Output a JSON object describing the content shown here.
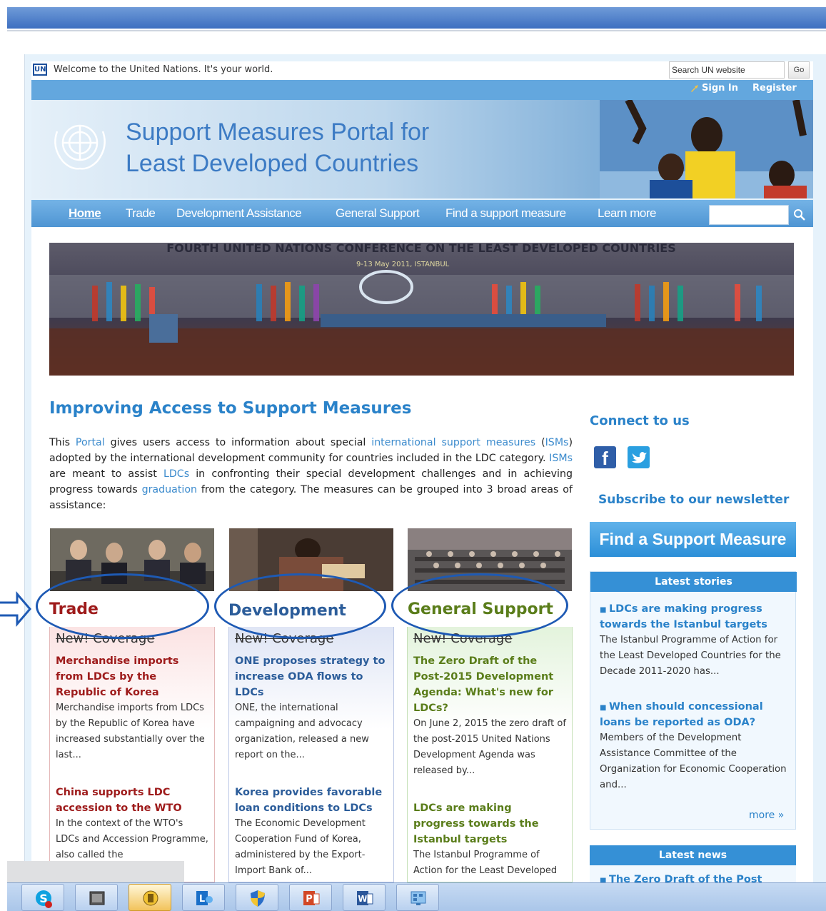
{
  "topbar": {
    "un_logo": "UN",
    "welcome": "Welcome to the United Nations. It's your world.",
    "search_value": "Search UN website",
    "go_label": "Go",
    "sign_in": "Sign In",
    "register": "Register"
  },
  "banner": {
    "title_line1": "Support Measures Portal for",
    "title_line2": "Least Developed Countries"
  },
  "nav": {
    "items": [
      "Home",
      "Trade",
      "Development Assistance",
      "General Support",
      "Find a support measure",
      "Learn more"
    ]
  },
  "hero": {
    "caption": "FOURTH UNITED NATIONS CONFERENCE ON THE LEAST DEVELOPED COUNTRIES",
    "subcaption": "9-13 May 2011, ISTANBUL"
  },
  "main": {
    "heading": "Improving Access to Support Measures",
    "intro": {
      "t1": "This ",
      "l1": "Portal",
      "t2": " gives users access to information about special ",
      "l2": "international support measures",
      "t3": " (",
      "l3": "ISMs",
      "t4": ") adopted by the international development community for countries included in the LDC category. ",
      "l4": "ISMs",
      "t5": " are meant to assist ",
      "l5": "LDCs",
      "t6": " in confronting their special development challenges and in achieving progress towards ",
      "l6": "graduation",
      "t7": " from the category. The measures can be grouped into 3 broad areas of assistance:"
    }
  },
  "columns": {
    "trade": {
      "title": "Trade",
      "color": "#9e1b1b",
      "new_coverage": "New! Coverage",
      "s1_title": "Merchandise imports from LDCs by the Republic of Korea",
      "s1_text": "Merchandise imports from LDCs by the Republic of Korea have increased substantially over the last...",
      "s2_title": "China supports LDC accession to the WTO",
      "s2_text": "In the context of the WTO's LDCs and Accession Programme, also called the"
    },
    "development": {
      "title": "Development",
      "color": "#2c5d9a",
      "new_coverage": "New! Coverage",
      "s1_title": "ONE proposes strategy to increase ODA flows to LDCs",
      "s1_text": "ONE, the international campaigning and advocacy organization, released a new report on the...",
      "s2_title": "Korea provides favorable loan conditions to LDCs",
      "s2_text": "The Economic Development Cooperation Fund of Korea, administered by the Export-Import Bank of..."
    },
    "general": {
      "title": "General Support",
      "color": "#5a7d1a",
      "new_coverage": "New! Coverage",
      "s1_title": "The Zero Draft of the Post-2015 Development Agenda: What's new for LDCs?",
      "s1_text": "On June 2, 2015 the zero draft of the post-2015 United Nations Development Agenda was released by...",
      "s2_title": "LDCs are making progress towards the Istanbul targets",
      "s2_text": "The Istanbul Programme of Action for the Least Developed"
    }
  },
  "sidebar": {
    "connect": "Connect to us",
    "fb": "f",
    "subscribe": "Subscribe to our newsletter",
    "find_button": "Find a Support Measure",
    "latest_stories": "Latest stories",
    "story1_title": "LDCs are making progress towards the Istanbul targets",
    "story1_text": "The Istanbul Programme of Action for the Least Developed Countries for the Decade 2011-2020 has...",
    "story2_title": "When should concessional loans be reported as ODA?",
    "story2_text": "Members of the Development Assistance Committee of the Organization for Economic Cooperation and...",
    "more": "more »",
    "latest_news": "Latest news",
    "news1_title": "The Zero Draft of the Post"
  },
  "taskbar": {
    "apps": [
      "skype-icon",
      "window-icon",
      "norton-icon",
      "lync-icon",
      "uac-shield-icon",
      "powerpoint-icon",
      "word-icon",
      "control-panel-icon"
    ],
    "ppt_letter": "P",
    "word_letter": "W",
    "lync_letter": "L"
  }
}
